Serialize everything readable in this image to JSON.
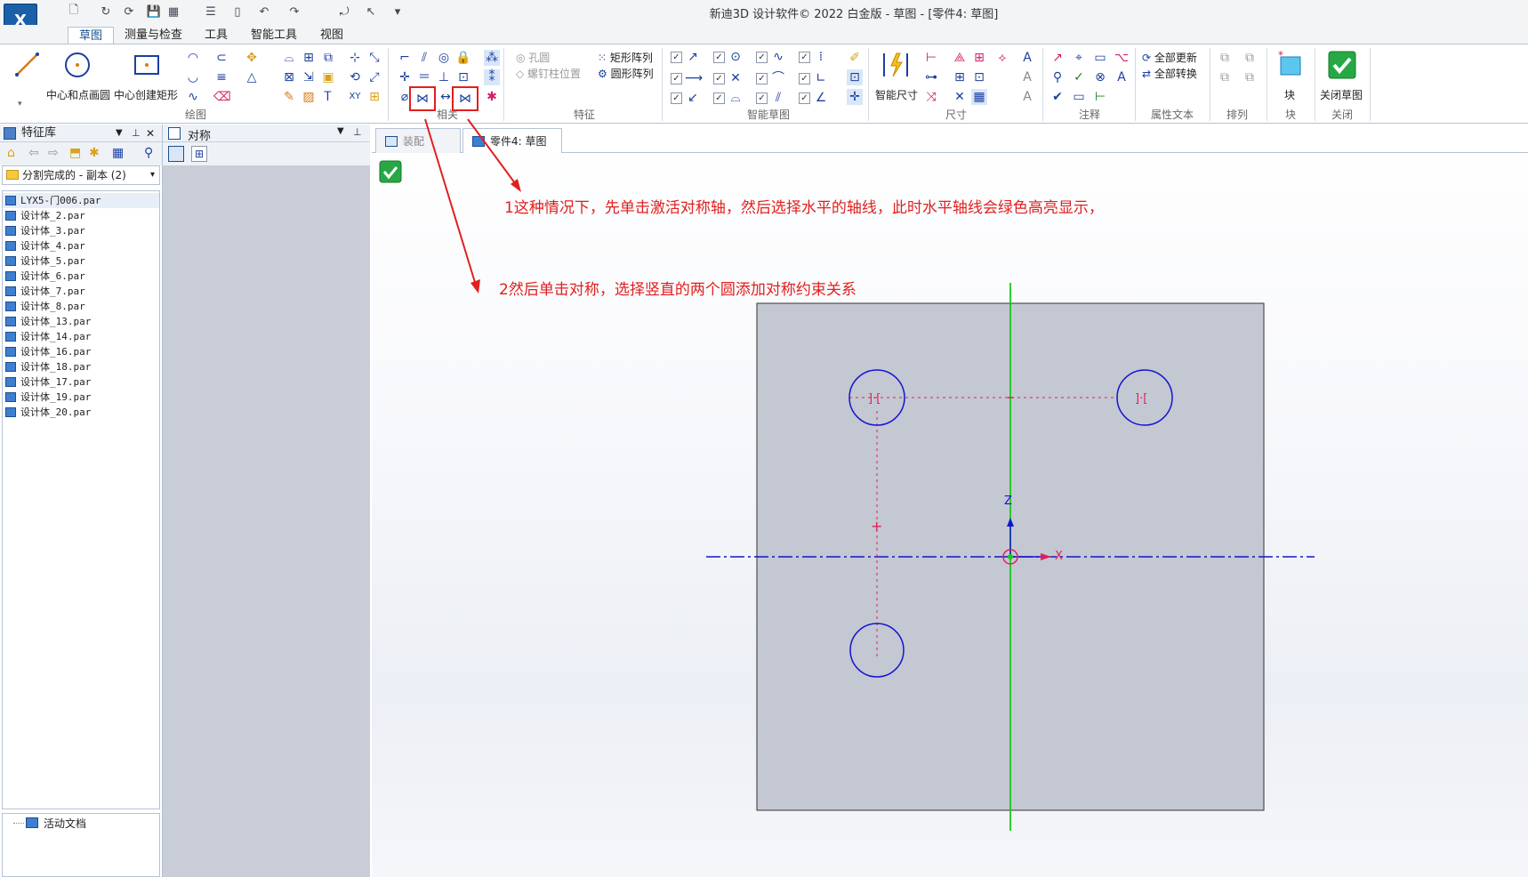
{
  "app": {
    "title": "新迪3D 设计软件© 2022 白金版 - 草图 - [零件4: 草图]",
    "logo_text": "X",
    "accent": "#1a5fa8"
  },
  "ribbon_tabs": [
    {
      "label": "草图",
      "active": true
    },
    {
      "label": "测量与检查"
    },
    {
      "label": "工具"
    },
    {
      "label": "智能工具"
    },
    {
      "label": "视图"
    }
  ],
  "ribbon": {
    "draw": {
      "center_circle_label": "中心和点画圆",
      "center_rect_label": "中心创建矩形",
      "group_label": "绘图"
    },
    "relate": {
      "group_label": "相关"
    },
    "feature": {
      "hole_label": "孔圆",
      "screw_label": "螺钉柱位置",
      "rect_array_label": "矩形阵列",
      "circ_array_label": "圆形阵列",
      "group_label": "特征"
    },
    "smart_sketch": {
      "group_label": "智能草图"
    },
    "dimension": {
      "smart_dim_label": "智能尺寸",
      "group_label": "尺寸"
    },
    "annotation": {
      "group_label": "注释"
    },
    "attr_text": {
      "update_all_label": "全部更新",
      "convert_all_label": "全部转换",
      "group_label": "属性文本"
    },
    "arrange": {
      "group_label": "排列"
    },
    "block": {
      "block_label": "块",
      "group_label": "块"
    },
    "close": {
      "close_sketch_label": "关闭草图",
      "group_label": "关闭"
    }
  },
  "feature_lib": {
    "title": "特征库",
    "folder": "分割完成的 - 副本 (2)",
    "files": [
      "LYX5-门006.par",
      "设计体_2.par",
      "设计体_3.par",
      "设计体_4.par",
      "设计体_5.par",
      "设计体_6.par",
      "设计体_7.par",
      "设计体_8.par",
      "设计体_13.par",
      "设计体_14.par",
      "设计体_16.par",
      "设计体_18.par",
      "设计体_17.par",
      "设计体_19.par",
      "设计体_20.par"
    ],
    "active_doc": "活动文档"
  },
  "symmetry_panel": {
    "title": "对称"
  },
  "doc_tabs": [
    {
      "label": "装配",
      "active": false
    },
    {
      "label": "零件4: 草图",
      "active": true
    }
  ],
  "annotations": {
    "note1": "1这种情况下，先单击激活对称轴，然后选择水平的轴线，此时水平轴线会绿色高亮显示，",
    "note2": "2然后单击对称，选择竖直的两个圆添加对称约束关系"
  },
  "canvas": {
    "axis_z": "Z",
    "axis_x": "X",
    "colors": {
      "plate": "#c3c8d2",
      "circle": "#1414d0",
      "vert_axis": "#19c919",
      "horiz_axis": "#1414d0",
      "constraint": "#e0205a",
      "annotation": "#e02020"
    }
  }
}
